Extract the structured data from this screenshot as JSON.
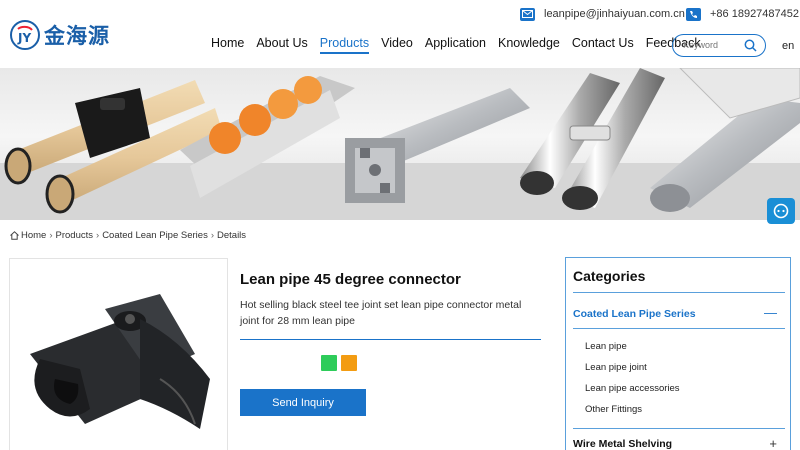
{
  "header": {
    "logo_text": "金海源",
    "email": "leanpipe@jinhaiyuan.com.cn",
    "phone": "+86 18927487452",
    "nav": [
      "Home",
      "About Us",
      "Products",
      "Video",
      "Application",
      "Knowledge",
      "Contact Us",
      "Feedback"
    ],
    "active_nav": "Products",
    "search_placeholder": "Keyword",
    "lang": "en"
  },
  "breadcrumb": [
    "Home",
    "Products",
    "Coated Lean Pipe Series",
    "Details"
  ],
  "product": {
    "title": "Lean pipe 45 degree connector",
    "description": "Hot selling black steel tee joint set lean pipe connector metal joint for 28 mm lean pipe",
    "colors": [
      "#2ecc5a",
      "#f39c12"
    ],
    "inquiry_label": "Send Inquiry"
  },
  "categories": {
    "title": "Categories",
    "groups": [
      {
        "name": "Coated Lean Pipe Series",
        "toggle": "—",
        "items": [
          "Lean pipe",
          "Lean pipe joint",
          "Lean pipe accessories",
          "Other Fittings"
        ]
      },
      {
        "name": "Wire Metal Shelving",
        "toggle": "+"
      }
    ]
  },
  "colors": {
    "accent": "#1a73c9"
  }
}
